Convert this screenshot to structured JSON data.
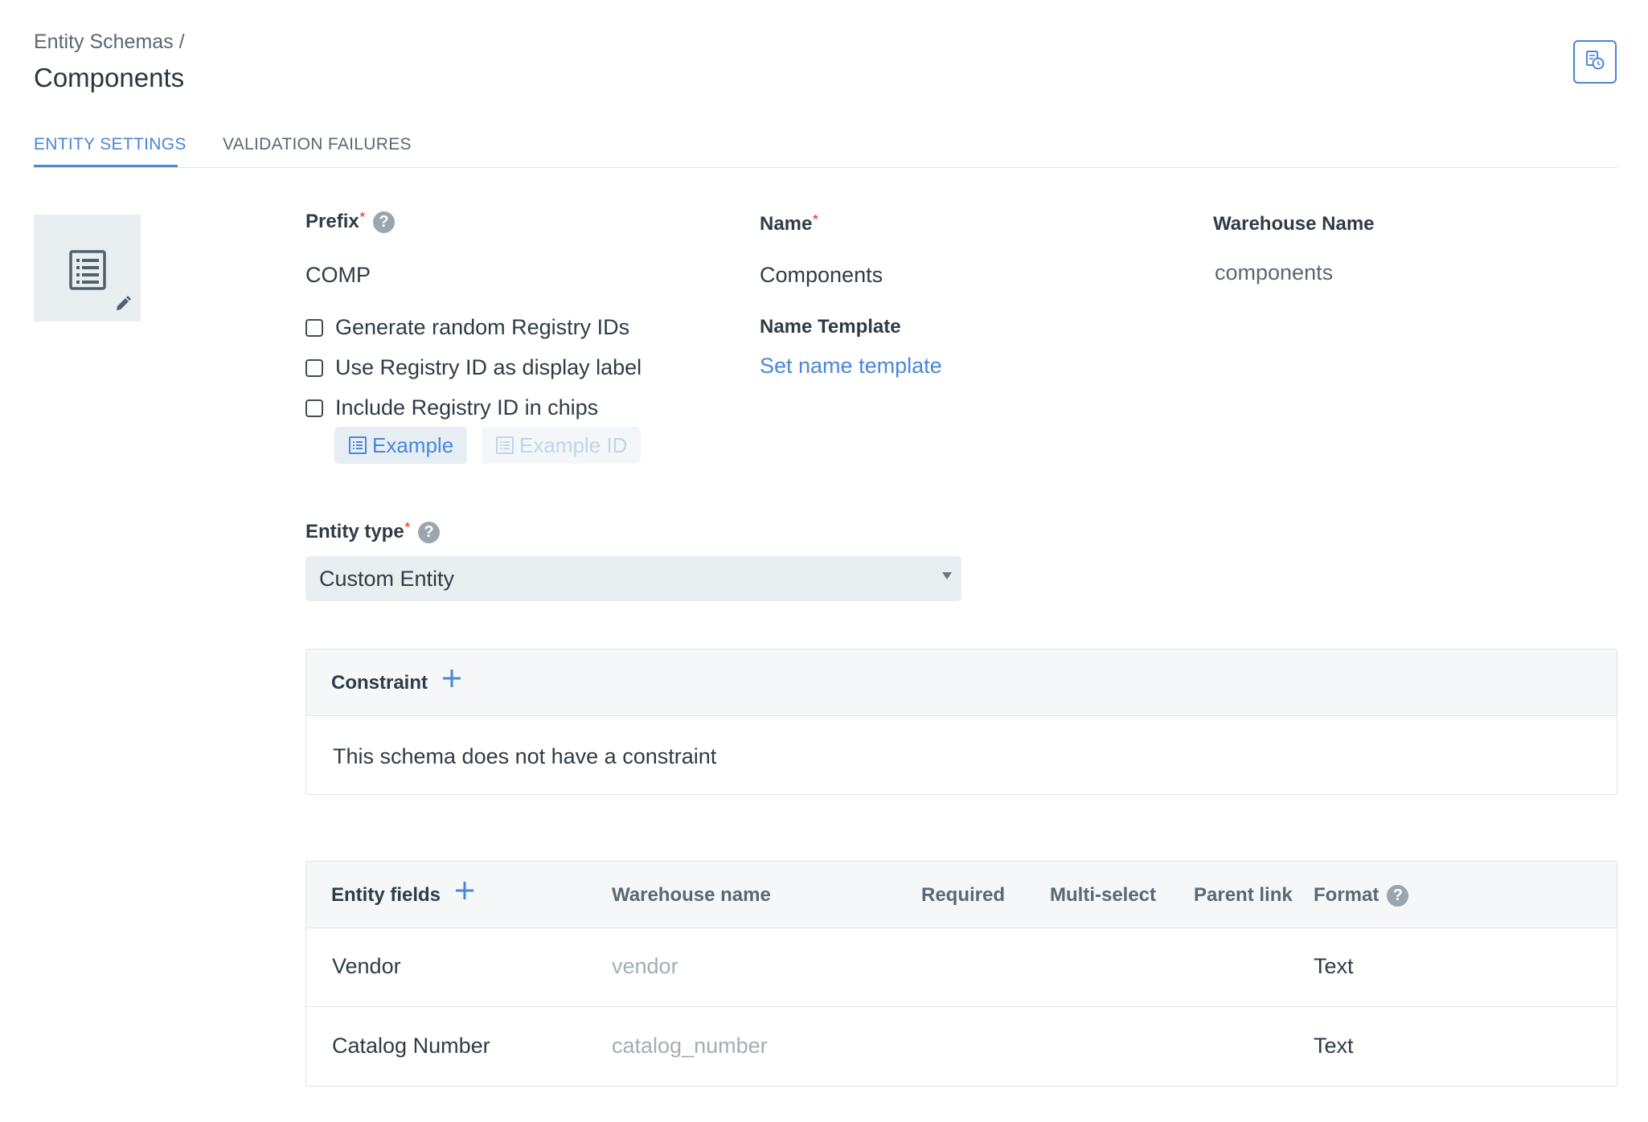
{
  "breadcrumb": "Entity Schemas /",
  "page_title": "Components",
  "tabs": [
    {
      "label": "ENTITY SETTINGS",
      "active": true
    },
    {
      "label": "VALIDATION FAILURES",
      "active": false
    }
  ],
  "icons": {
    "history": "history-icon",
    "schema": "list-document-icon",
    "edit": "pencil-icon",
    "help": "question-circle-icon",
    "add": "plus-icon",
    "dropdown": "caret-down-icon"
  },
  "prefix": {
    "label": "Prefix",
    "required_mark": "*",
    "value": "COMP"
  },
  "name": {
    "label": "Name",
    "required_mark": "*",
    "value": "Components"
  },
  "warehouse": {
    "label": "Warehouse Name",
    "value": "components"
  },
  "name_template": {
    "label": "Name Template",
    "link": "Set name template"
  },
  "checkboxes": [
    {
      "label": "Generate random Registry IDs",
      "checked": false
    },
    {
      "label": "Use Registry ID as display label",
      "checked": false
    },
    {
      "label": "Include Registry ID in chips",
      "checked": false
    }
  ],
  "chips": {
    "example": "Example",
    "example_id": "Example ID"
  },
  "entity_type": {
    "label": "Entity type",
    "required_mark": "*",
    "selected": "Custom Entity"
  },
  "constraint": {
    "title": "Constraint",
    "empty_text": "This schema does not have a constraint"
  },
  "fields": {
    "columns": {
      "name": "Entity fields",
      "warehouse": "Warehouse name",
      "required": "Required",
      "multi": "Multi-select",
      "parent": "Parent link",
      "format": "Format"
    },
    "rows": [
      {
        "name": "Vendor",
        "warehouse": "vendor",
        "format": "Text"
      },
      {
        "name": "Catalog Number",
        "warehouse": "catalog_number",
        "format": "Text"
      }
    ]
  },
  "colors": {
    "accent": "#4a86d9",
    "required": "#e0554a",
    "panel_header": "#f5f7f9",
    "icon_tile": "#e9eef1"
  }
}
